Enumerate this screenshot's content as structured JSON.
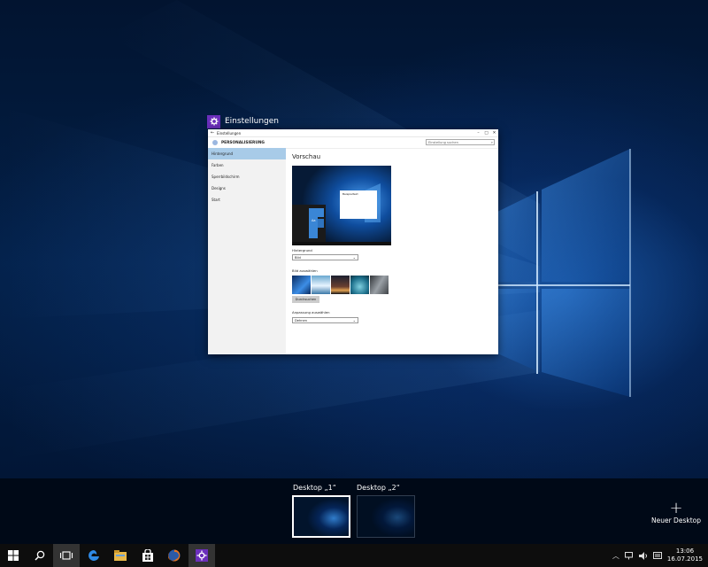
{
  "window_label": "Einstellungen",
  "settings": {
    "title": "Einstellungen",
    "section": "PERSONALISIERUNG",
    "search_placeholder": "Einstellung suchen",
    "nav": [
      "Hintergrund",
      "Farben",
      "Sperrbildschirm",
      "Designs",
      "Start"
    ],
    "active_nav": "Hintergrund",
    "preview_title": "Vorschau",
    "preview_sample_text": "Beispieltext",
    "preview_tile_text": "Aa",
    "background_label": "Hintergrund",
    "background_value": "Bild",
    "choose_image_label": "Bild auswählen",
    "browse_button": "Durchsuchen",
    "fit_label": "Anpassung auswählen",
    "fit_value": "Dehnen"
  },
  "taskview": {
    "desktops": [
      "Desktop „1“",
      "Desktop „2“"
    ],
    "selected": "Desktop „1“",
    "new_desktop": "Neuer Desktop"
  },
  "taskbar": {
    "time": "13:06",
    "date": "16.07.2015"
  },
  "colors": {
    "accent": "#6b2fbb",
    "taskbar": "#0d0d0d",
    "desktop": "#02142c",
    "nav_active": "#a8cbe8"
  }
}
